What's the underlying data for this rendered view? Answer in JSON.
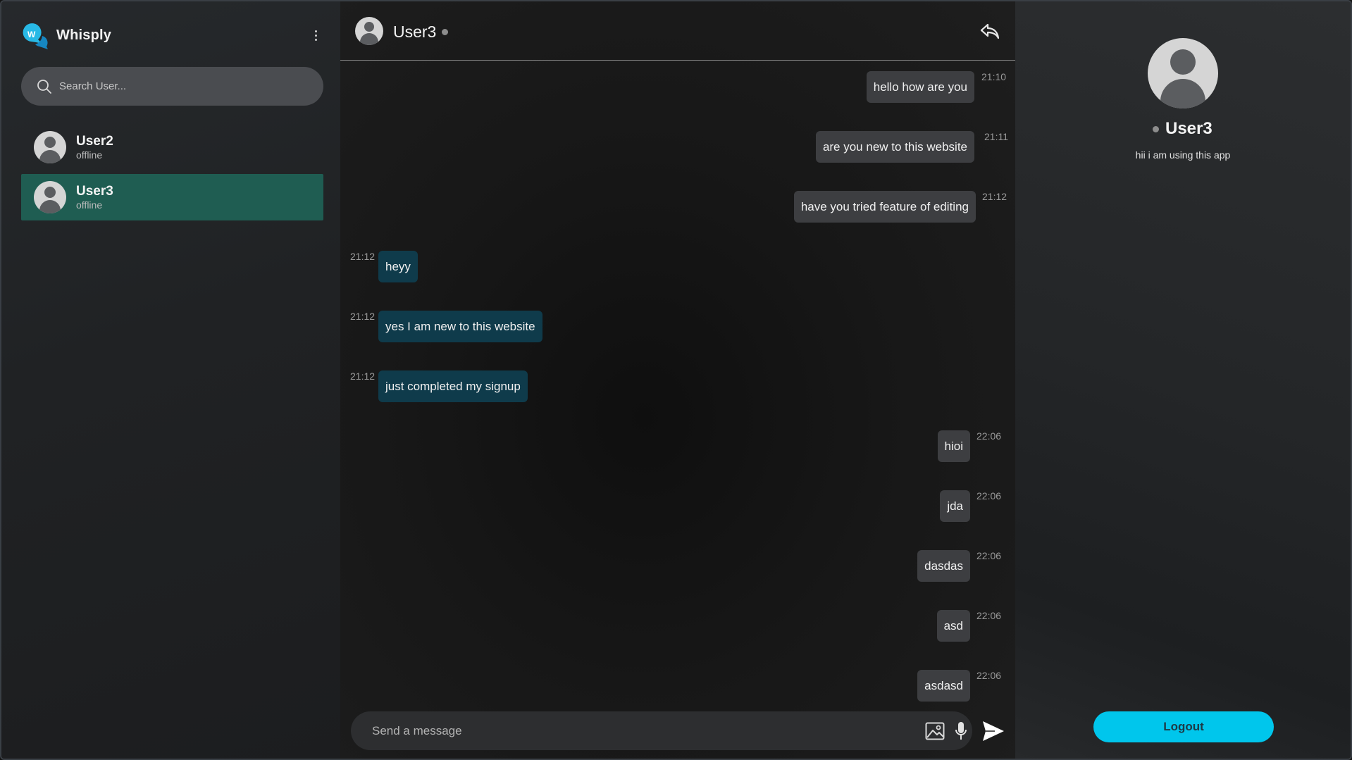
{
  "app": {
    "name": "Whisply",
    "logo_letter": "W",
    "accent": "#00c6ec"
  },
  "sidebar": {
    "search_placeholder": "Search User...",
    "contacts": [
      {
        "name": "User2",
        "status": "offline",
        "active": false
      },
      {
        "name": "User3",
        "status": "offline",
        "active": true
      }
    ]
  },
  "chat": {
    "header": {
      "name": "User3"
    },
    "messages": [
      {
        "direction": "out",
        "text": "hello how are you",
        "time": "21:10"
      },
      {
        "direction": "out",
        "text": "are you new to this website",
        "time": "21:11"
      },
      {
        "direction": "out",
        "text": "have you tried feature of editing",
        "time": "21:12"
      },
      {
        "direction": "in",
        "text": "heyy",
        "time": "21:12"
      },
      {
        "direction": "in",
        "text": "yes I am new to this website",
        "time": "21:12"
      },
      {
        "direction": "in",
        "text": "just completed my signup",
        "time": "21:12"
      },
      {
        "direction": "out",
        "text": "hioi",
        "time": "22:06"
      },
      {
        "direction": "out",
        "text": "jda",
        "time": "22:06"
      },
      {
        "direction": "out",
        "text": "dasdas",
        "time": "22:06"
      },
      {
        "direction": "out",
        "text": "asd",
        "time": "22:06"
      },
      {
        "direction": "out",
        "text": "asdasd",
        "time": "22:06"
      }
    ],
    "composer_placeholder": "Send a message"
  },
  "profile": {
    "name": "User3",
    "bio": "hii i am using this app",
    "logout_label": "Logout"
  },
  "icons": {
    "menu": "kebab-menu-icon",
    "search": "search-icon",
    "back": "reply-back-icon",
    "image": "image-icon",
    "mic": "microphone-icon",
    "send": "send-icon"
  }
}
